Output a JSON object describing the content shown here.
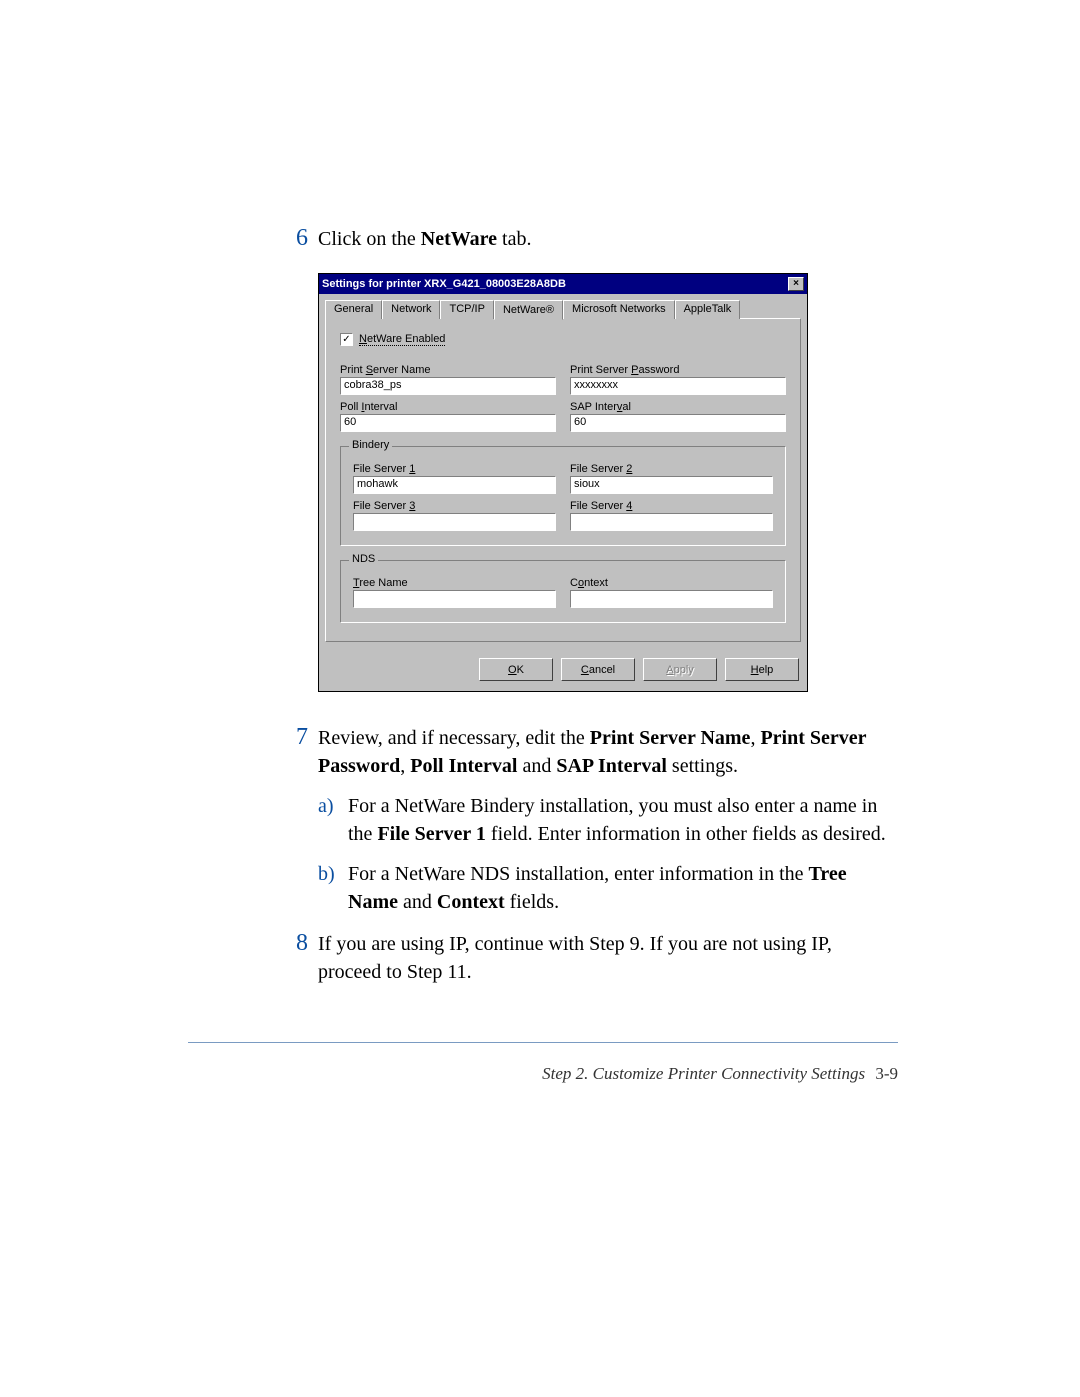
{
  "steps": {
    "s6": {
      "num": "6",
      "pre": "Click on the ",
      "bold": "NetWare",
      "post": " tab."
    },
    "s7": {
      "num": "7",
      "pre": "Review, and if necessary, edit the ",
      "b1": "Print Server Name",
      "c1": ", ",
      "b2": "Print Server Password",
      "c2": ", ",
      "b3": "Poll Interval",
      "c3": " and ",
      "b4": "SAP Interval",
      "post": " settings."
    },
    "s7a": {
      "letter": "a)",
      "pre": "For a NetWare Bindery installation, you must also enter a name in the ",
      "b1": "File Server 1",
      "post": " field. Enter information in other fields as desired."
    },
    "s7b": {
      "letter": "b)",
      "pre": "For a NetWare NDS installation, enter information in the ",
      "b1": "Tree Name",
      "mid": " and ",
      "b2": "Context",
      "post": " fields."
    },
    "s8": {
      "num": "8",
      "text": "If you are using IP, continue with Step 9. If you are not using IP, proceed to Step 11."
    }
  },
  "dialog": {
    "title": "Settings for printer XRX_G421_08003E28A8DB",
    "close": "×",
    "tabs": {
      "general": "General",
      "network": "Network",
      "tcpip": "TCP/IP",
      "netware": "NetWare®",
      "msnet": "Microsoft Networks",
      "appletalk": "AppleTalk"
    },
    "checkbox": {
      "mark": "✓",
      "labelN": "N",
      "labelRest": "etWare Enabled"
    },
    "fields": {
      "psname": {
        "labelPre": "Print ",
        "labelU": "S",
        "labelPost": "erver Name",
        "value": "cobra38_ps"
      },
      "pspass": {
        "labelPre": "Print Server ",
        "labelU": "P",
        "labelPost": "assword",
        "value": "xxxxxxxx"
      },
      "poll": {
        "labelPre": "Poll ",
        "labelU": "I",
        "labelPost": "nterval",
        "value": "60"
      },
      "sap": {
        "labelPre": "SAP Inter",
        "labelU": "v",
        "labelPost": "al",
        "value": "60"
      }
    },
    "bindery": {
      "title": "Bindery",
      "fs1": {
        "labelPre": "File Server ",
        "labelU": "1",
        "value": "mohawk"
      },
      "fs2": {
        "labelPre": "File Server ",
        "labelU": "2",
        "value": "sioux"
      },
      "fs3": {
        "labelPre": "File Server ",
        "labelU": "3",
        "value": ""
      },
      "fs4": {
        "labelPre": "File Server ",
        "labelU": "4",
        "value": ""
      }
    },
    "nds": {
      "title": "NDS",
      "tree": {
        "labelU": "T",
        "labelPost": "ree Name",
        "value": ""
      },
      "ctx": {
        "labelPre": "C",
        "labelU": "o",
        "labelPost": "ntext",
        "value": ""
      }
    },
    "buttons": {
      "ok": {
        "u": "O",
        "rest": "K"
      },
      "cancel": {
        "u": "C",
        "rest": "ancel"
      },
      "apply": {
        "u": "A",
        "rest": "pply"
      },
      "help": {
        "u": "H",
        "rest": "elp"
      }
    }
  },
  "footer": {
    "text": "Step 2. Customize Printer Connectivity Settings",
    "page": "3-9"
  }
}
